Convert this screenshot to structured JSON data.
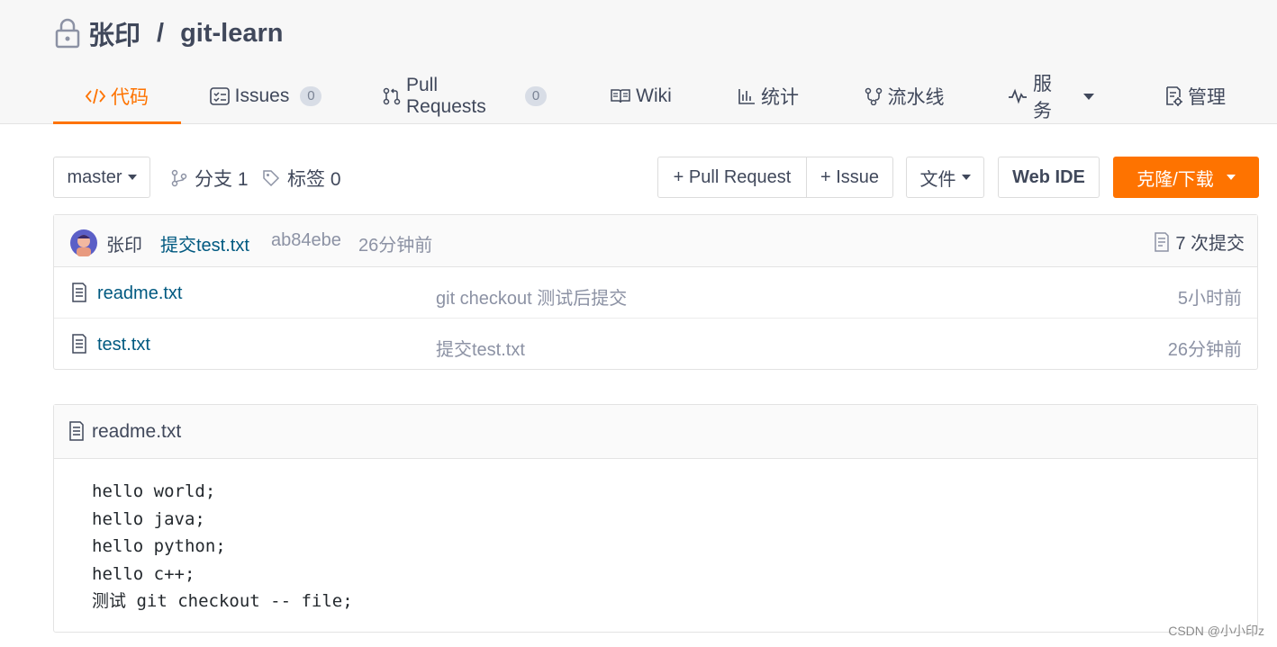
{
  "repo": {
    "owner": "张印",
    "separator": "/",
    "name": "git-learn"
  },
  "tabs": [
    {
      "label": "代码",
      "icon": "code-icon"
    },
    {
      "label": "Issues",
      "count": "0",
      "icon": "issues-icon"
    },
    {
      "label": "Pull Requests",
      "count": "0",
      "icon": "pull-request-icon"
    },
    {
      "label": "Wiki",
      "icon": "wiki-book-icon"
    },
    {
      "label": "统计",
      "icon": "bar-chart-icon"
    },
    {
      "label": "流水线",
      "icon": "pipeline-icon"
    },
    {
      "label": "服务",
      "icon": "pulse-icon"
    },
    {
      "label": "管理",
      "icon": "manage-icon"
    }
  ],
  "toolbar": {
    "branch": "master",
    "branches_label": "分支 1",
    "tags_label": "标签 0",
    "pull_request_label": "+ Pull Request",
    "issue_label": "+ Issue",
    "file_label": "文件",
    "web_ide_label": "Web IDE",
    "clone_label": "克隆/下载"
  },
  "last_commit": {
    "author": "张印",
    "message": "提交test.txt",
    "hash": "ab84ebe",
    "time": "26分钟前",
    "commit_count": "7 次提交"
  },
  "files": [
    {
      "name": "readme.txt",
      "message": "git checkout 测试后提交",
      "time": "5小时前"
    },
    {
      "name": "test.txt",
      "message": "提交test.txt",
      "time": "26分钟前"
    }
  ],
  "readme": {
    "title": "readme.txt",
    "lines": [
      "hello world;",
      "hello java;",
      "hello python;",
      "hello c++;",
      "测试 git checkout -- file;"
    ]
  },
  "watermark": "CSDN @小小印z",
  "colors": {
    "accent": "#fe7300",
    "link": "#005980",
    "text": "#40485b",
    "muted": "#8c92a4"
  }
}
